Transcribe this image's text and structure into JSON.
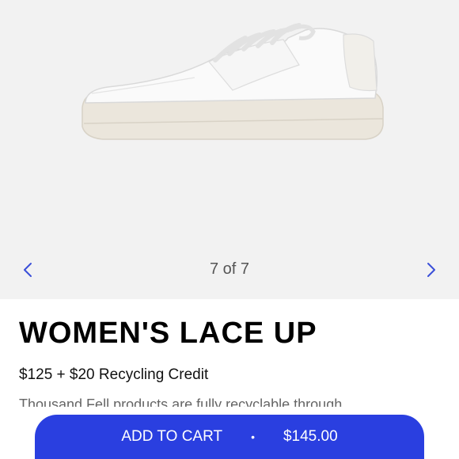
{
  "gallery": {
    "counter": "7 of 7",
    "prev_icon": "chevron-left-icon",
    "next_icon": "chevron-right-icon",
    "image": "white-sneaker-side-view"
  },
  "product": {
    "title": "WOMEN'S LACE UP",
    "price_line": "$125 + $20 Recycling Credit",
    "description": "Thousand Fell products are fully recyclable through"
  },
  "cart": {
    "label": "ADD TO CART",
    "separator": "•",
    "total": "$145.00"
  },
  "colors": {
    "accent": "#2a3fe0",
    "gallery_bg": "#f2f2f2",
    "chevron": "#3a4fd9"
  }
}
